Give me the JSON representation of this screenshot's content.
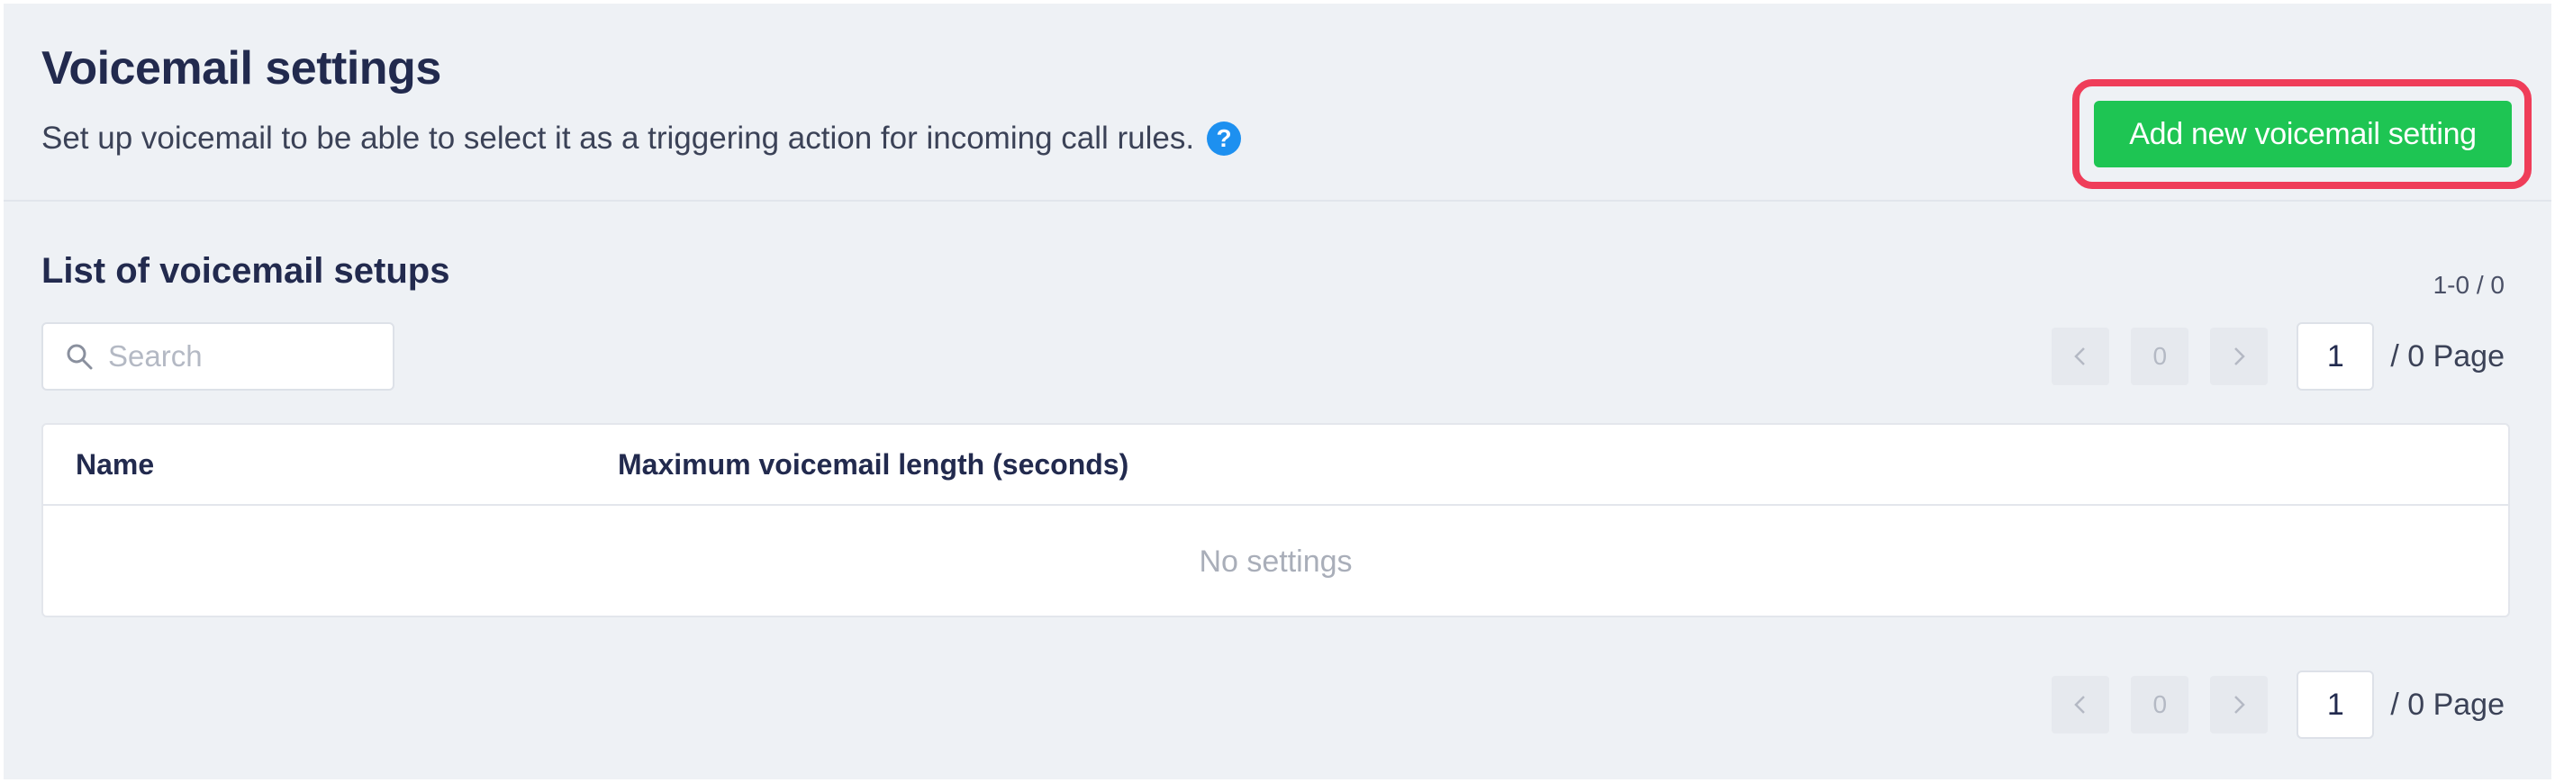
{
  "header": {
    "title": "Voicemail settings",
    "subtitle": "Set up voicemail to be able to select it as a triggering action for incoming call rules.",
    "help_icon": "question-circle-icon",
    "add_button_label": "Add new voicemail setting"
  },
  "list": {
    "title": "List of voicemail setups",
    "count_text": "1-0 / 0",
    "search": {
      "placeholder": "Search",
      "value": ""
    },
    "pagination_top": {
      "prev_icon": "chevron-left-icon",
      "current": "0",
      "next_icon": "chevron-right-icon",
      "page_input": "1",
      "page_label": "/ 0 Page"
    },
    "pagination_bottom": {
      "prev_icon": "chevron-left-icon",
      "current": "0",
      "next_icon": "chevron-right-icon",
      "page_input": "1",
      "page_label": "/ 0 Page"
    },
    "table": {
      "columns": [
        "Name",
        "Maximum voicemail length (seconds)"
      ],
      "rows": [],
      "empty_text": "No settings"
    }
  },
  "colors": {
    "accent_green": "#1ec553",
    "highlight_red": "#ef3d59",
    "help_blue": "#1d90f0",
    "background": "#eef1f5"
  }
}
